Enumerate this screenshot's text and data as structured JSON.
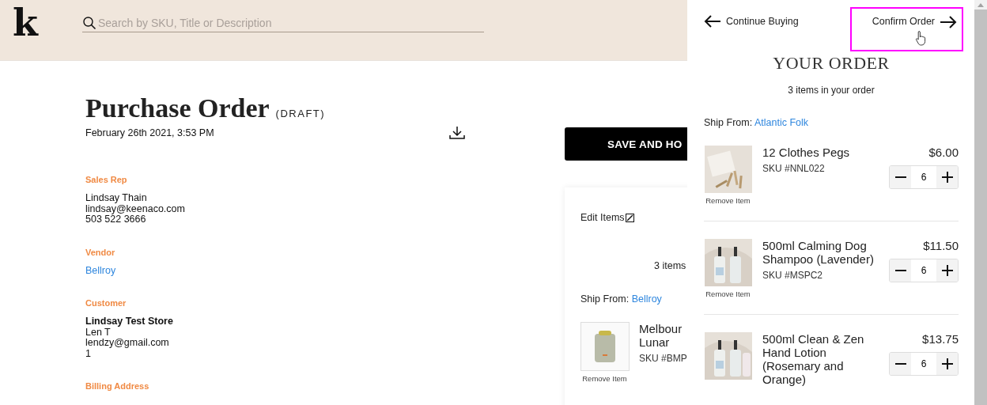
{
  "header": {
    "logo": "k",
    "search": {
      "placeholder": "Search by SKU, Title or Description"
    }
  },
  "purchase_order": {
    "title": "Purchase Order",
    "status": "(DRAFT)",
    "date": "February 26th 2021, 3:53 PM",
    "save_button": "SAVE AND HO",
    "sections": [
      {
        "label": "Sales Rep",
        "lines": [
          {
            "kind": "plain",
            "text": "Lindsay Thain"
          },
          {
            "kind": "plain",
            "text": "lindsay@keenaco.com"
          },
          {
            "kind": "plain",
            "text": "503 522 3666"
          }
        ]
      },
      {
        "label": "Vendor",
        "lines": [
          {
            "kind": "link",
            "text": "Bellroy"
          }
        ]
      },
      {
        "label": "Customer",
        "lines": [
          {
            "kind": "bold",
            "text": "Lindsay Test Store"
          },
          {
            "kind": "plain",
            "text": "Len T"
          },
          {
            "kind": "plain",
            "text": "lendzy@gmail.com"
          },
          {
            "kind": "plain",
            "text": "1"
          }
        ]
      },
      {
        "label": "Billing Address"
      }
    ]
  },
  "items_card": {
    "edit_label": "Edit Items",
    "count": "3 items",
    "ship_from_label": "Ship From:",
    "vendor": "Bellroy",
    "items": [
      {
        "title_lines": [
          "Melbour",
          "Lunar"
        ],
        "sku": "SKU #BMP",
        "remove": "Remove Item"
      }
    ]
  },
  "drawer": {
    "back": "Continue Buying",
    "confirm": "Confirm Order",
    "highlighted": true,
    "title": "YOUR ORDER",
    "count": "3 items in your order",
    "ship_from_label": "Ship From:",
    "vendor": "Atlantic Folk",
    "items": [
      {
        "title": "12 Clothes Pegs",
        "sku": "SKU #NNL022",
        "price": "$6.00",
        "quantity": "6",
        "remove": "Remove Item"
      },
      {
        "title": "500ml Calming Dog Shampoo (Lavender)",
        "sku": "SKU #MSPC2",
        "price": "$11.50",
        "quantity": "6",
        "remove": "Remove Item"
      },
      {
        "title": "500ml Clean & Zen Hand Lotion (Rosemary and Orange)",
        "price": "$13.75",
        "quantity": "6"
      }
    ]
  }
}
